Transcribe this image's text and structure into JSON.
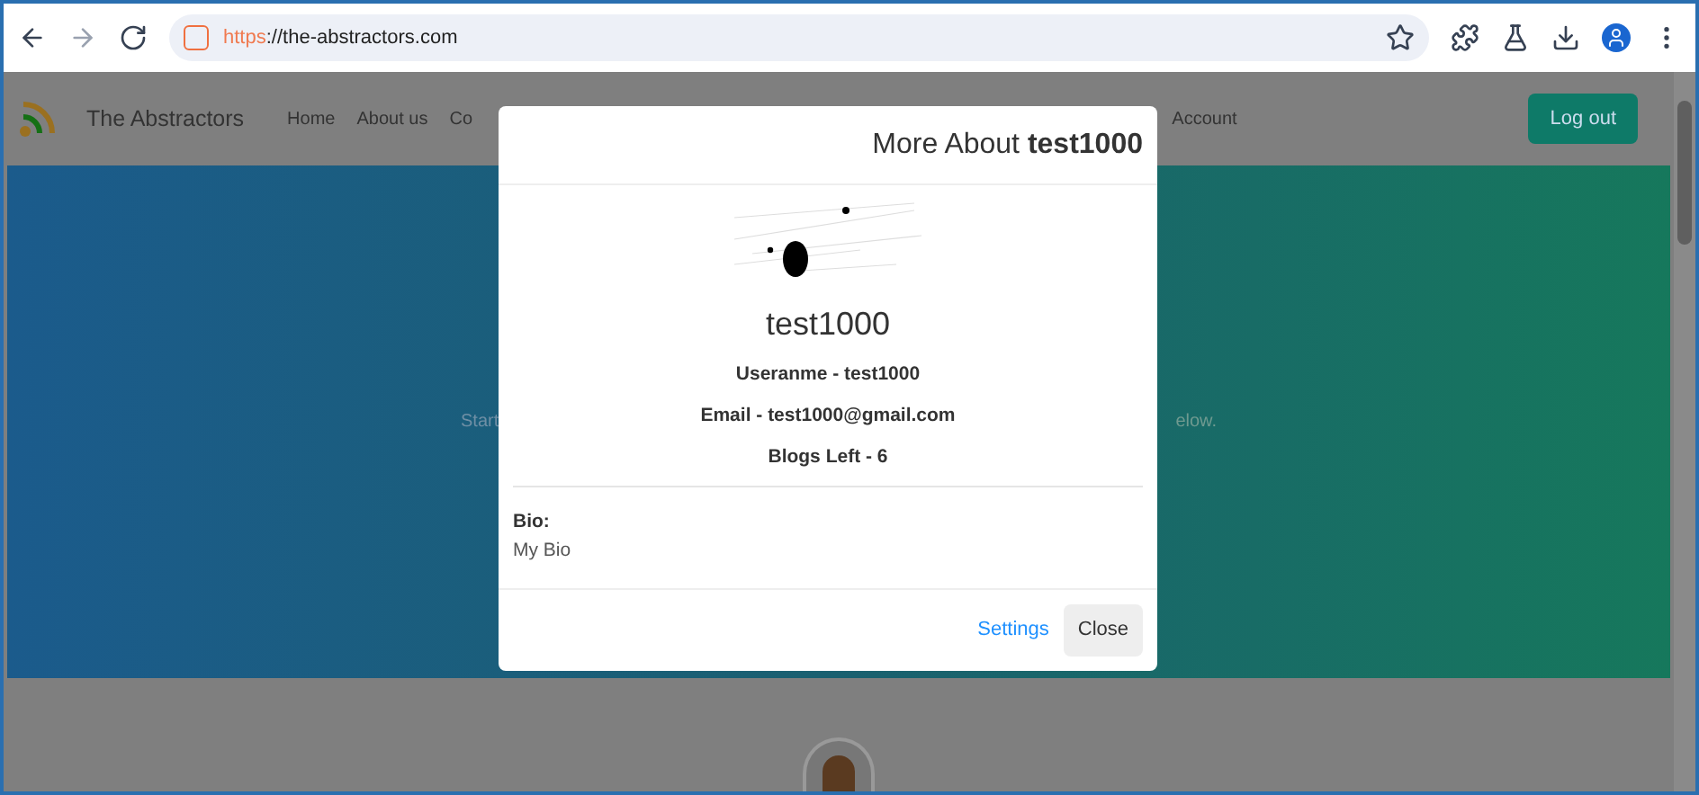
{
  "browser": {
    "url_scheme": "https",
    "url_rest": "://the-abstractors.com",
    "back_disabled": false,
    "forward_disabled": true
  },
  "navbar": {
    "brand": "The Abstractors",
    "links": [
      "Home",
      "About us",
      "Co"
    ],
    "right_links": [
      "Account"
    ],
    "logout": "Log out"
  },
  "hero": {
    "text_left": "Start",
    "text_right": "elow."
  },
  "modal": {
    "title_prefix": "More About ",
    "title_user": "test1000",
    "name": "test1000",
    "details": [
      "Useranme - test1000",
      "Email - test1000@gmail.com",
      "Blogs Left - 6"
    ],
    "bio_label": "Bio:",
    "bio": "My Bio",
    "buttons": [
      {
        "kind": "link",
        "label": "Settings"
      },
      {
        "kind": "button",
        "label": "Close"
      }
    ]
  }
}
